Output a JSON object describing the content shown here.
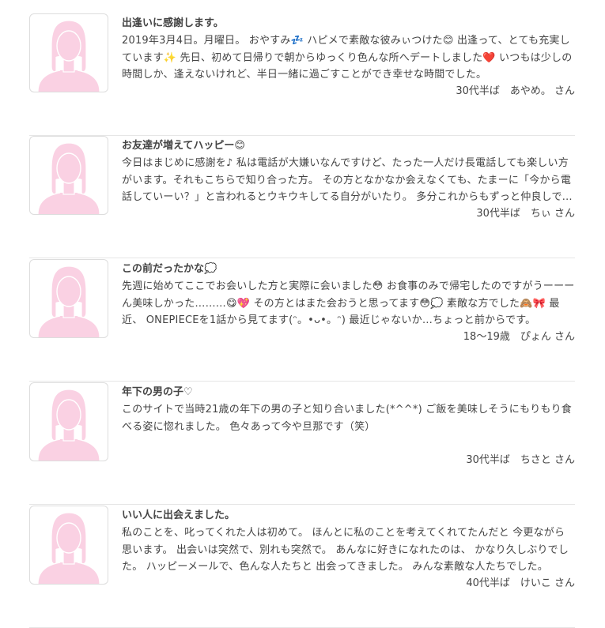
{
  "colors": {
    "avatar_fill": "#fad1e3",
    "avatar_outline": "#ffffff",
    "divider": "#e6e6e6",
    "text": "#444444"
  },
  "avatar_icon": "female-silhouette-icon",
  "entries": [
    {
      "title": "出逢いに感謝します。",
      "body": "2019年3月4日。月曜日。 おやすみ💤 ハピメで素敵な彼みぃつけた😊 出逢って、とても充実しています✨ 先日、初めて日帰りで朝からゆっくり色んな所へデートしました❤️ いつもは少しの時間しか、逢えないけれど、半日一緒に過ごすことができ幸せな時間でした。",
      "author": "30代半ば　あやめ。 さん"
    },
    {
      "title": "お友達が増えてハッピー😊",
      "body": "今日はまじめに感謝を♪ 私は電話が大嫌いなんですけど、たった一人だけ長電話しても楽しい方がいます。それもこちらで知り合った方。 その方となかなか会えなくても、たまーに「今から電話していーい？」と言われるとウキウキしてる自分がいたり。 多分これからもずっと仲良しです。",
      "author": "30代半ば　ちぃ さん"
    },
    {
      "title": "この前だったかな💭",
      "body": "先週に始めてここでお会いした方と実際に会いました😳 お食事のみで帰宅したのですがうーーーん美味しかった………😋💖 その方とはまた会おうと思ってます😳💭 素敵な方でした🙈🎀 最近、 ONEPIECEを1話から見てます(ᵔ。•ᴗ•。ᵔ) 最近じゃないか…ちょっと前からです。",
      "author": "18〜19歳　ぴょん さん"
    },
    {
      "title": "年下の男の子♡",
      "body": "このサイトで当時21歳の年下の男の子と知り合いました(*^^*) ご飯を美味しそうにもりもり食べる姿に惚れました。 色々あって今や旦那です（笑）",
      "author": "30代半ば　ちさと さん"
    },
    {
      "title": "いい人に出会えました。",
      "body": "私のことを、叱ってくれた人は初めて。 ほんとに私のことを考えてくれてたんだと 今更ながら思います。 出会いは突然で、別れも突然で。 あんなに好きになれたのは、 かなり久しぶりでした。 ハッピーメールで、色んな人たちと 出会ってきました。 みんな素敵な人たちでした。",
      "author": "40代半ば　けいこ さん"
    }
  ]
}
